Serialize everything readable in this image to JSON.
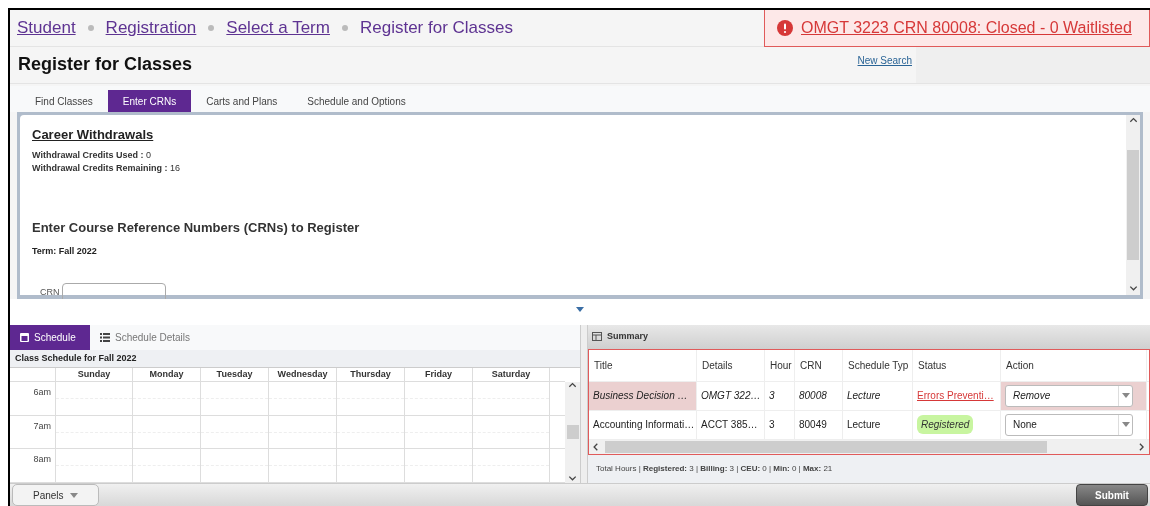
{
  "breadcrumb": [
    {
      "label": "Student",
      "kind": "link"
    },
    {
      "label": "Registration",
      "kind": "link"
    },
    {
      "label": "Select a Term",
      "kind": "link"
    },
    {
      "label": "Register for Classes",
      "kind": "current"
    }
  ],
  "alert": {
    "text": "OMGT 3223 CRN 80008: Closed - 0 Waitlisted"
  },
  "page_title": "Register for Classes",
  "new_search": "New Search",
  "tabs": [
    {
      "label": "Find Classes",
      "selected": false
    },
    {
      "label": "Enter CRNs",
      "selected": true
    },
    {
      "label": "Carts and Plans",
      "selected": false
    },
    {
      "label": "Schedule and Options",
      "selected": false
    }
  ],
  "withdrawals": {
    "heading": "Career Withdrawals",
    "used_label": "Withdrawal Credits Used :",
    "used_value": "0",
    "remaining_label": "Withdrawal Credits Remaining :",
    "remaining_value": "16"
  },
  "crn_section": {
    "heading": "Enter Course Reference Numbers (CRNs) to Register",
    "term": "Term: Fall 2022",
    "crn_label": "CRN"
  },
  "bottom_tabs": [
    {
      "label": "Schedule",
      "selected": true
    },
    {
      "label": "Schedule Details",
      "selected": false
    }
  ],
  "schedule": {
    "title": "Class Schedule for Fall 2022",
    "days": [
      "Sunday",
      "Monday",
      "Tuesday",
      "Wednesday",
      "Thursday",
      "Friday",
      "Saturday"
    ],
    "times": [
      "6am",
      "7am",
      "8am"
    ]
  },
  "summary": {
    "title": "Summary",
    "columns": [
      "Title",
      "Details",
      "Hour",
      "CRN",
      "Schedule Typ",
      "Status",
      "Action"
    ],
    "rows": [
      {
        "error": true,
        "title": "Business Decision …",
        "details": "OMGT 322…",
        "hours": "3",
        "crn": "80008",
        "type": "Lecture",
        "status": {
          "text": "Errors Preventi…",
          "kind": "error"
        },
        "action": "Remove"
      },
      {
        "error": false,
        "title": "Accounting Informati…",
        "details": "ACCT 385…",
        "hours": "3",
        "crn": "80049",
        "type": "Lecture",
        "status": {
          "text": "Registered",
          "kind": "registered"
        },
        "action": "None"
      }
    ],
    "totals": "Total Hours | **Registered:** 3 | **Billing:** 3 | **CEU:** 0 | **Min:** 0 | **Max:** 21"
  },
  "panels_button": "Panels",
  "submit_button": "Submit"
}
